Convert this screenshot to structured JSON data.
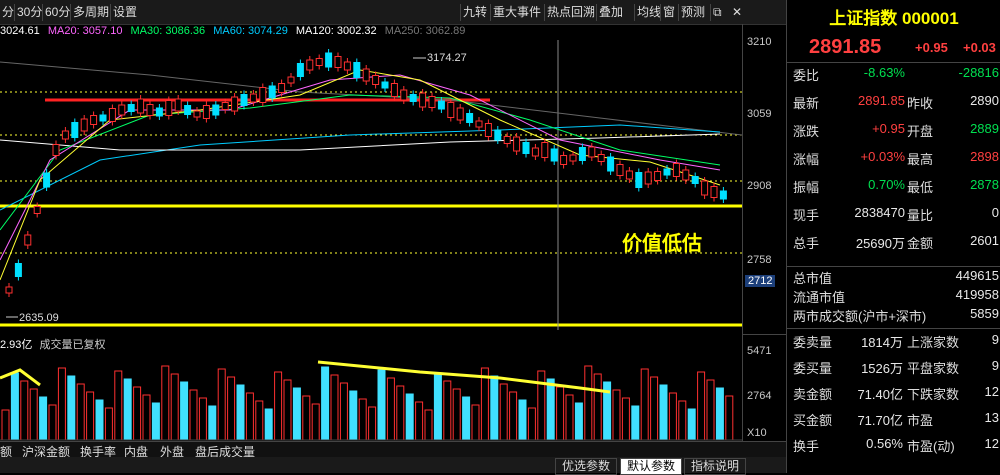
{
  "toolbar": {
    "left": [
      "分",
      "30分",
      "60分",
      "多周期",
      "设置"
    ],
    "right": [
      "九转",
      "重大事件",
      "热点回溯",
      "叠加",
      "均线",
      "窗",
      "预测"
    ]
  },
  "ma_legend": [
    {
      "label": "3024.61",
      "color": "#ffffff"
    },
    {
      "label": "MA20: 3057.10",
      "color": "#ff66ff"
    },
    {
      "label": "MA30: 3086.36",
      "color": "#00ff66"
    },
    {
      "label": "MA60: 3074.29",
      "color": "#00ccff"
    },
    {
      "label": "MA120: 3002.32",
      "color": "#ffffff"
    },
    {
      "label": "MA250: 3062.89",
      "color": "#666666"
    }
  ],
  "price_axis": [
    "3210",
    "3059",
    "2908",
    "2758",
    "2712"
  ],
  "chart_annotations": {
    "high_label": "3174.27",
    "low_label": "2635.09",
    "value_text": "价值低估"
  },
  "volume": {
    "legend": "2.93亿",
    "legend_note": "成交量已复权",
    "axis": [
      "5471",
      "2764",
      "X10"
    ]
  },
  "bottom_tabs": [
    "额",
    "沪深金额",
    "换手率",
    "内盘",
    "外盘",
    "盘后成交量"
  ],
  "footer_tabs": [
    "优选参数",
    "默认参数",
    "指标说明"
  ],
  "quote": {
    "title": "上证指数 000001",
    "price": "2891.85",
    "change": "+0.95",
    "change_pct": "+0.03",
    "rows": [
      {
        "l1": "委比",
        "v1": "-8.63%",
        "c1": "green",
        "l2": "",
        "v2": "-28816",
        "c2": "green"
      },
      {
        "l1": "最新",
        "v1": "2891.85",
        "c1": "red",
        "l2": "昨收",
        "v2": "2890",
        "c2": "white"
      },
      {
        "l1": "涨跌",
        "v1": "+0.95",
        "c1": "red",
        "l2": "开盘",
        "v2": "2889",
        "c2": "green"
      },
      {
        "l1": "涨幅",
        "v1": "+0.03%",
        "c1": "red",
        "l2": "最高",
        "v2": "2898",
        "c2": "red"
      },
      {
        "l1": "振幅",
        "v1": "0.70%",
        "c1": "green",
        "l2": "最低",
        "v2": "2878",
        "c2": "green"
      },
      {
        "l1": "现手",
        "v1": "2838470",
        "c1": "white",
        "l2": "量比",
        "v2": "0",
        "c2": "white"
      },
      {
        "l1": "总手",
        "v1": "25690万",
        "c1": "white",
        "l2": "金额",
        "v2": "2601",
        "c2": "white"
      }
    ],
    "cap_rows": [
      {
        "l": "总市值",
        "v": "449615"
      },
      {
        "l": "流通市值",
        "v": "419958"
      },
      {
        "l": "两市成交额(沪市+深市)",
        "v": "5859"
      }
    ],
    "stat_rows": [
      {
        "l1": "委卖量",
        "v1": "1814万",
        "l2": "上涨家数",
        "v2": "9"
      },
      {
        "l1": "委买量",
        "v1": "1526万",
        "l2": "平盘家数",
        "v2": "9"
      },
      {
        "l1": "卖金额",
        "v1": "71.40亿",
        "l2": "下跌家数",
        "v2": "12"
      },
      {
        "l1": "买金额",
        "v1": "71.70亿",
        "l2": "市盈",
        "v2": "13"
      },
      {
        "l1": "换手",
        "v1": "0.56%",
        "l2": "市盈(动)",
        "v2": "12"
      }
    ]
  }
}
